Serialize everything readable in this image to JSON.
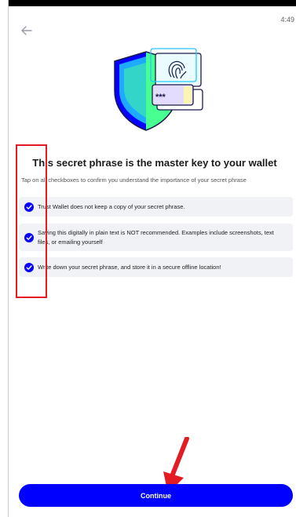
{
  "status": {
    "time": "4:49"
  },
  "header": {
    "back_icon": "arrow-left-icon"
  },
  "hero": {
    "illustration": "shield-fingerprint-password-illustration",
    "password_mask": "***"
  },
  "main": {
    "title": "This secret phrase is the master key to your wallet",
    "subtitle": "Tap on all checkboxes to confirm you understand the importance of your secret phrase",
    "checkboxes": [
      {
        "label": "Trust Wallet does not keep a copy of your secret phrase.",
        "checked": true
      },
      {
        "label": "Saving this digitally in plain text is NOT recommended. Examples include screenshots, text files, or emailing yourself",
        "checked": true
      },
      {
        "label": "Write down your secret phrase, and store it in a secure offline location!",
        "checked": true
      }
    ]
  },
  "footer": {
    "continue_label": "Continue"
  },
  "colors": {
    "accent": "#0000ff",
    "check": "#0500ff",
    "annotation": "#e31b23",
    "item_bg": "#f1f2f5"
  }
}
